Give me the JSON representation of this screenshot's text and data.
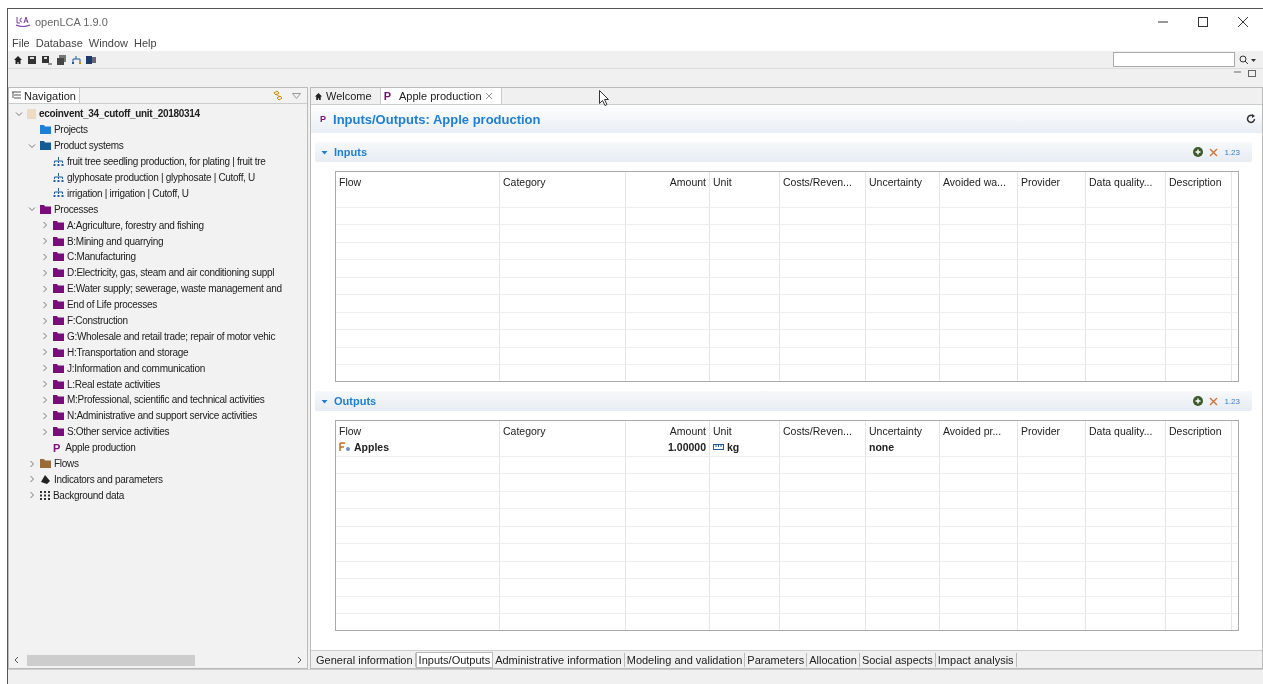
{
  "window": {
    "title": "openLCA 1.9.0"
  },
  "menu": [
    "File",
    "Database",
    "Window",
    "Help"
  ],
  "navigation": {
    "title": "Navigation",
    "tree": [
      {
        "label": "ecoinvent_34_cutoff_unit_20180314",
        "kind": "database",
        "expanded": true,
        "children": [
          {
            "label": "Projects",
            "kind": "projects"
          },
          {
            "label": "Product systems",
            "kind": "systems",
            "expanded": true,
            "children": [
              {
                "label": "fruit tree seedling production, for plating | fruit tre",
                "kind": "system"
              },
              {
                "label": "glyphosate production | glyphosate | Cutoff, U",
                "kind": "system"
              },
              {
                "label": "irrigation | irrigation | Cutoff, U",
                "kind": "system"
              }
            ]
          },
          {
            "label": "Processes",
            "kind": "processes",
            "expanded": true,
            "children": [
              {
                "label": "A:Agriculture, forestry and fishing",
                "kind": "folder",
                "expanded": false
              },
              {
                "label": "B:Mining and quarrying",
                "kind": "folder",
                "expanded": false
              },
              {
                "label": "C:Manufacturing",
                "kind": "folder",
                "expanded": false
              },
              {
                "label": "D:Electricity, gas, steam and air conditioning suppl",
                "kind": "folder",
                "expanded": false
              },
              {
                "label": "E:Water supply; sewerage, waste management and",
                "kind": "folder",
                "expanded": false
              },
              {
                "label": "End of Life processes",
                "kind": "folder",
                "expanded": false
              },
              {
                "label": "F:Construction",
                "kind": "folder",
                "expanded": false
              },
              {
                "label": "G:Wholesale and retail trade; repair of motor vehic",
                "kind": "folder",
                "expanded": false
              },
              {
                "label": "H:Transportation and storage",
                "kind": "folder",
                "expanded": false
              },
              {
                "label": "J:Information and communication",
                "kind": "folder",
                "expanded": false
              },
              {
                "label": "L:Real estate activities",
                "kind": "folder",
                "expanded": false
              },
              {
                "label": "M:Professional, scientific and technical activities",
                "kind": "folder",
                "expanded": false
              },
              {
                "label": "N:Administrative and support service activities",
                "kind": "folder",
                "expanded": false
              },
              {
                "label": "S:Other service activities",
                "kind": "folder",
                "expanded": false
              },
              {
                "label": "Apple production",
                "kind": "process",
                "icon_text": "P"
              }
            ]
          },
          {
            "label": "Flows",
            "kind": "flows",
            "expanded": false
          },
          {
            "label": "Indicators and parameters",
            "kind": "indicators",
            "expanded": false
          },
          {
            "label": "Background data",
            "kind": "background",
            "expanded": false
          }
        ]
      }
    ]
  },
  "editor_tabs": [
    {
      "label": "Welcome",
      "kind": "home",
      "selected": false
    },
    {
      "label": "Apple production",
      "kind": "process",
      "icon_text": "P",
      "selected": true
    }
  ],
  "editor": {
    "icon_text": "P",
    "title": "Inputs/Outputs: Apple production",
    "sections": [
      {
        "title": "Inputs",
        "expanded": true,
        "amount_format": "1.23",
        "columns": [
          "Flow",
          "Category",
          "Amount",
          "Unit",
          "Costs/Reven...",
          "Uncertainty",
          "Avoided wa...",
          "Provider",
          "Data quality...",
          "Description"
        ]
      },
      {
        "title": "Outputs",
        "expanded": true,
        "amount_format": "1.23",
        "columns": [
          "Flow",
          "Category",
          "Amount",
          "Unit",
          "Costs/Reven...",
          "Uncertainty",
          "Avoided pr...",
          "Provider",
          "Data quality...",
          "Description"
        ],
        "rows": [
          {
            "flow": "Apples",
            "amount": "1.00000",
            "unit": "kg",
            "uncertainty": "none"
          }
        ]
      }
    ]
  },
  "page_tabs": [
    {
      "label": "General information",
      "selected": false
    },
    {
      "label": "Inputs/Outputs",
      "selected": true
    },
    {
      "label": "Administrative information",
      "selected": false
    },
    {
      "label": "Modeling and validation",
      "selected": false
    },
    {
      "label": "Parameters",
      "selected": false
    },
    {
      "label": "Allocation",
      "selected": false
    },
    {
      "label": "Social aspects",
      "selected": false
    },
    {
      "label": "Impact analysis",
      "selected": false
    }
  ]
}
